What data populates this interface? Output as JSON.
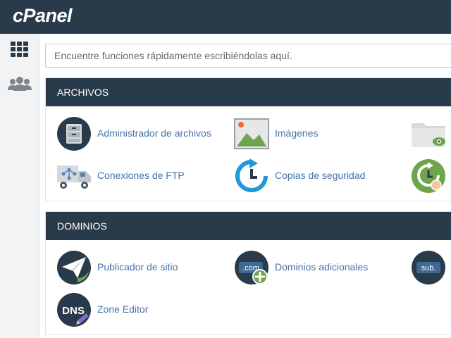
{
  "header": {
    "logo": "cPanel"
  },
  "sidebar": {
    "items": [
      {
        "icon": "grid-icon"
      },
      {
        "icon": "users-icon"
      }
    ]
  },
  "search": {
    "placeholder": "Encuentre funciones rápidamente escribiéndolas aquí."
  },
  "sections": [
    {
      "title": "ARCHIVOS",
      "items": [
        {
          "label": "Administrador de archivos",
          "icon": "file-manager-icon"
        },
        {
          "label": "Imágenes",
          "icon": "images-icon"
        },
        {
          "label": "",
          "icon": "directory-privacy-icon"
        },
        {
          "label": "Conexiones de FTP",
          "icon": "ftp-connections-icon"
        },
        {
          "label": "Copias de seguridad",
          "icon": "backup-icon"
        },
        {
          "label": "",
          "icon": "backup-wizard-icon"
        }
      ]
    },
    {
      "title": "DOMINIOS",
      "items": [
        {
          "label": "Publicador de sitio",
          "icon": "site-publisher-icon"
        },
        {
          "label": "Dominios adicionales",
          "icon": "addon-domains-icon"
        },
        {
          "label": "",
          "icon": "subdomains-icon",
          "icon_text": "sub."
        },
        {
          "label": "Zone Editor",
          "icon": "zone-editor-icon",
          "icon_text": "DNS"
        }
      ],
      "addon_icon_text": ".com"
    }
  ],
  "colors": {
    "header": "#293a4a",
    "link": "#4673a8",
    "background": "#f1f3f5"
  }
}
